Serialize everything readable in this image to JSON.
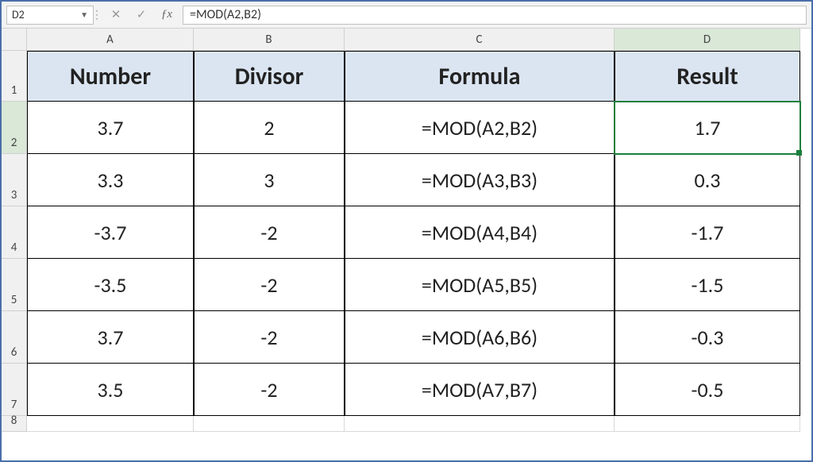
{
  "formula_bar": {
    "name_box": "D2",
    "formula": "=MOD(A2,B2)"
  },
  "columns": [
    "A",
    "B",
    "C",
    "D"
  ],
  "rows": [
    "1",
    "2",
    "3",
    "4",
    "5",
    "6",
    "7",
    "8"
  ],
  "headers": {
    "A": "Number",
    "B": "Divisor",
    "C": "Formula",
    "D": "Result"
  },
  "data": [
    {
      "number": "3.7",
      "divisor": "2",
      "formula": "=MOD(A2,B2)",
      "result": "1.7"
    },
    {
      "number": "3.3",
      "divisor": "3",
      "formula": "=MOD(A3,B3)",
      "result": "0.3"
    },
    {
      "number": "-3.7",
      "divisor": "-2",
      "formula": "=MOD(A4,B4)",
      "result": "-1.7"
    },
    {
      "number": "-3.5",
      "divisor": "-2",
      "formula": "=MOD(A5,B5)",
      "result": "-1.5"
    },
    {
      "number": "3.7",
      "divisor": "-2",
      "formula": "=MOD(A6,B6)",
      "result": "-0.3"
    },
    {
      "number": "3.5",
      "divisor": "-2",
      "formula": "=MOD(A7,B7)",
      "result": "-0.5"
    }
  ],
  "active_col": "D",
  "active_row": "2"
}
